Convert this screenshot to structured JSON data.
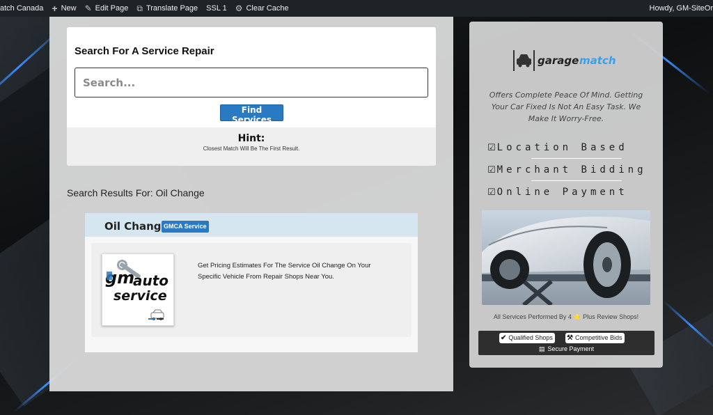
{
  "adminbar": {
    "items": [
      {
        "label": "atch Canada",
        "icon": ""
      },
      {
        "label": "New",
        "icon": "plus-icon"
      },
      {
        "label": "Edit Page",
        "icon": "pencil-icon"
      },
      {
        "label": "Translate Page",
        "icon": "translate-icon"
      },
      {
        "label": "SSL 1",
        "icon": ""
      },
      {
        "label": "Clear Cache",
        "icon": "cache-icon"
      }
    ],
    "howdy": "Howdy, GM-SiteOr"
  },
  "search": {
    "title": "Search For A Service Repair",
    "placeholder": "Search...",
    "button_label": "Find Services",
    "hint_title": "Hint:",
    "hint_text": "Closest Match Will Be The First Result."
  },
  "results": {
    "heading": "Search Results For: Oil Change",
    "items": [
      {
        "title": "Oil Change",
        "badge": "GMCA Service",
        "thumb_line1": "gm",
        "thumb_line1b": "auto",
        "thumb_line2": "service",
        "description": "Get Pricing Estimates For The Service Oil Change On Your Specific Vehicle From Repair Shops Near You."
      }
    ]
  },
  "sidebar": {
    "logo_text_a": "garage",
    "logo_text_b": "match",
    "tagline": "Offers Complete Peace Of Mind. Getting Your Car Fixed Is Not An Easy Task. We Make It Worry-Free.",
    "features": [
      "Location Based",
      "Merchant Bidding",
      "Online Payment"
    ],
    "services_line": "All Services Performed By 4 ⭐ Plus Review Shops!",
    "pills": [
      {
        "label": "Qualified Shops",
        "icon": "check-circle-icon"
      },
      {
        "label": "Competitive Bids",
        "icon": "gavel-icon"
      }
    ],
    "secure_label": "Secure Payment"
  },
  "colors": {
    "accent": "#2a7ac3",
    "logo_blue": "#3aa0e8",
    "admin_bar": "#1d2327"
  }
}
